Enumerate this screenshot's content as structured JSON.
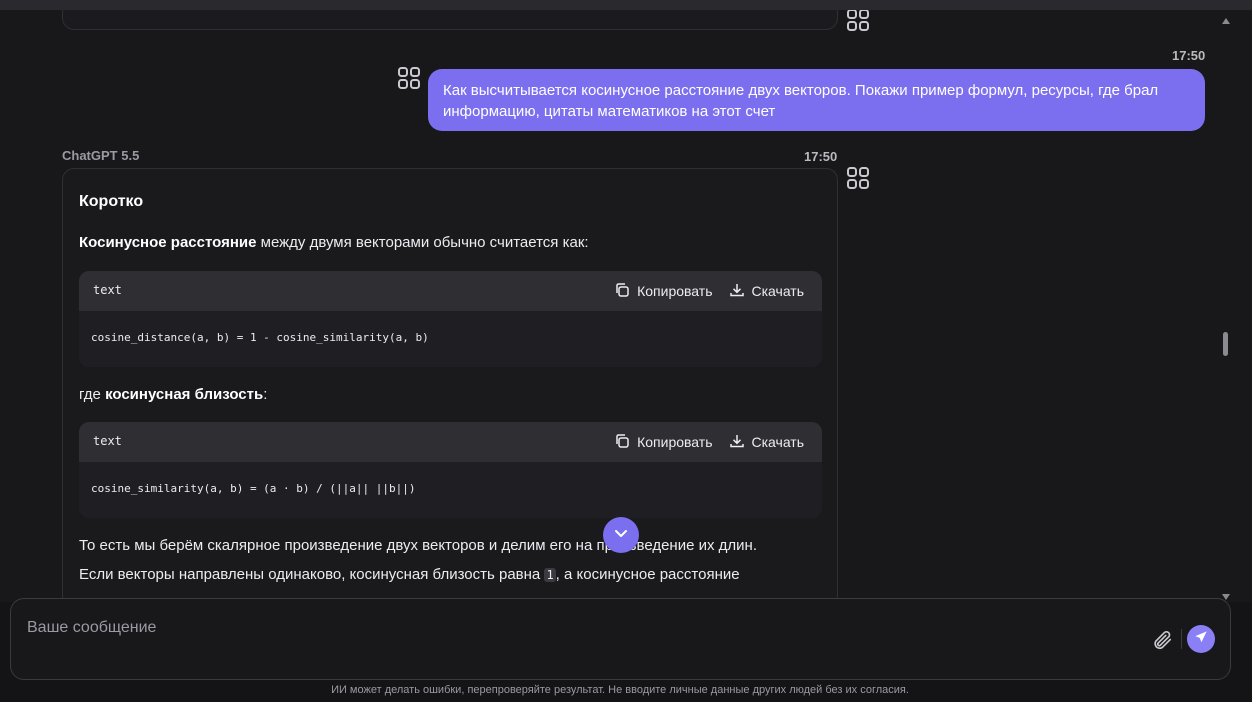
{
  "user_message": {
    "time": "17:50",
    "text": "Как высчитывается косинусное расстояние двух векторов. Покажи пример формул, ресурсы, где брал информацию, цитаты математиков на этот счет"
  },
  "assistant_message": {
    "model": "ChatGPT 5.5",
    "time": "17:50",
    "heading": "Коротко",
    "p1_bold": "Косинусное расстояние",
    "p1_rest": " между двумя векторами обычно считается как:",
    "code1": {
      "lang": "text",
      "copy_label": "Копировать",
      "download_label": "Скачать",
      "code": "cosine_distance(a, b) = 1 - cosine_similarity(a, b)"
    },
    "p2_pre": "где ",
    "p2_bold": "косинусная близость",
    "p2_post": ":",
    "code2": {
      "lang": "text",
      "copy_label": "Копировать",
      "download_label": "Скачать",
      "code": "cosine_similarity(a, b) = (a · b) / (||a|| ||b||)"
    },
    "p3": "То есть мы берём скалярное произведение двух векторов и делим его на произведение их длин.",
    "p4_pre": "Если векторы направлены одинаково, косинусная близость равна ",
    "p4_code": "1",
    "p4_post": ", а косинусное расстояние"
  },
  "composer": {
    "placeholder": "Ваше сообщение"
  },
  "disclaimer": "ИИ может делать ошибки, перепроверяйте результат. Не вводите личные данные других людей без их согласия.",
  "colors": {
    "accent": "#7b6ff0",
    "background": "#18181b",
    "card_border": "#2f2f34"
  },
  "icons": {
    "message_action": "grid-four-squares-icon",
    "copy": "copy-icon",
    "download": "download-icon",
    "scroll_down": "chevron-down-icon",
    "attach": "paperclip-icon",
    "send": "send-arrow-icon"
  }
}
